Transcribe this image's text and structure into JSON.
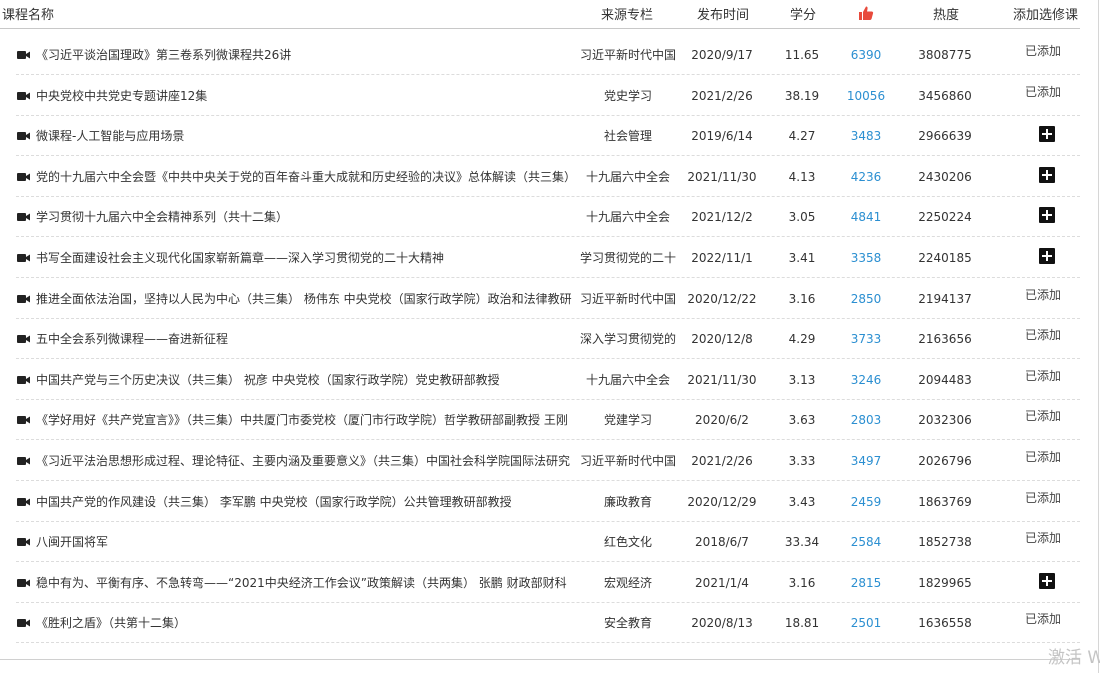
{
  "header": {
    "title": "课程名称",
    "source": "来源专栏",
    "date": "发布时间",
    "score": "学分",
    "likes_icon": "thumbs-up-icon",
    "heat": "热度",
    "action": "添加选修课"
  },
  "colors": {
    "likes": "#2b8fd1",
    "thumb": "#e84a3c",
    "plus": "#111111"
  },
  "rows": [
    {
      "title": "《习近平谈治国理政》第三卷系列微课程共26讲",
      "source": "习近平新时代中国",
      "date": "2020/9/17",
      "score": "11.65",
      "likes": "6390",
      "heat": "3808775",
      "status": "已添加"
    },
    {
      "title": "中央党校中共党史专题讲座12集",
      "source": "党史学习",
      "date": "2021/2/26",
      "score": "38.19",
      "likes": "10056",
      "heat": "3456860",
      "status": "已添加"
    },
    {
      "title": "微课程-人工智能与应用场景",
      "source": "社会管理",
      "date": "2019/6/14",
      "score": "4.27",
      "likes": "3483",
      "heat": "2966639",
      "status": ""
    },
    {
      "title": "党的十九届六中全会暨《中共中央关于党的百年奋斗重大成就和历史经验的决议》总体解读（共三集）",
      "source": "十九届六中全会",
      "date": "2021/11/30",
      "score": "4.13",
      "likes": "4236",
      "heat": "2430206",
      "status": ""
    },
    {
      "title": "学习贯彻十九届六中全会精神系列（共十二集）",
      "source": "十九届六中全会",
      "date": "2021/12/2",
      "score": "3.05",
      "likes": "4841",
      "heat": "2250224",
      "status": ""
    },
    {
      "title": "书写全面建设社会主义现代化国家崭新篇章——深入学习贯彻党的二十大精神",
      "source": "学习贯彻党的二十",
      "date": "2022/11/1",
      "score": "3.41",
      "likes": "3358",
      "heat": "2240185",
      "status": ""
    },
    {
      "title": "推进全面依法治国，坚持以人民为中心（共三集） 杨伟东 中央党校（国家行政学院）政治和法律教研",
      "source": "习近平新时代中国",
      "date": "2020/12/22",
      "score": "3.16",
      "likes": "2850",
      "heat": "2194137",
      "status": "已添加"
    },
    {
      "title": "五中全会系列微课程——奋进新征程",
      "source": "深入学习贯彻党的",
      "date": "2020/12/8",
      "score": "4.29",
      "likes": "3733",
      "heat": "2163656",
      "status": "已添加"
    },
    {
      "title": "中国共产党与三个历史决议（共三集） 祝彦 中央党校（国家行政学院）党史教研部教授",
      "source": "十九届六中全会",
      "date": "2021/11/30",
      "score": "3.13",
      "likes": "3246",
      "heat": "2094483",
      "status": "已添加"
    },
    {
      "title": "《学好用好《共产党宣言》》（共三集）中共厦门市委党校（厦门市行政学院）哲学教研部副教授 王刚",
      "source": "党建学习",
      "date": "2020/6/2",
      "score": "3.63",
      "likes": "2803",
      "heat": "2032306",
      "status": "已添加"
    },
    {
      "title": "《习近平法治思想形成过程、理论特征、主要内涵及重要意义》（共三集）中国社会科学院国际法研究",
      "source": "习近平新时代中国",
      "date": "2021/2/26",
      "score": "3.33",
      "likes": "3497",
      "heat": "2026796",
      "status": "已添加"
    },
    {
      "title": "中国共产党的作风建设（共三集） 李军鹏 中央党校（国家行政学院）公共管理教研部教授",
      "source": "廉政教育",
      "date": "2020/12/29",
      "score": "3.43",
      "likes": "2459",
      "heat": "1863769",
      "status": "已添加"
    },
    {
      "title": "八闽开国将军",
      "source": "红色文化",
      "date": "2018/6/7",
      "score": "33.34",
      "likes": "2584",
      "heat": "1852738",
      "status": "已添加"
    },
    {
      "title": "稳中有为、平衡有序、不急转弯——“2021中央经济工作会议”政策解读（共两集） 张鹏 财政部财科",
      "source": "宏观经济",
      "date": "2021/1/4",
      "score": "3.16",
      "likes": "2815",
      "heat": "1829965",
      "status": ""
    },
    {
      "title": "《胜利之盾》（共第十二集）",
      "source": "安全教育",
      "date": "2020/8/13",
      "score": "18.81",
      "likes": "2501",
      "heat": "1636558",
      "status": "已添加"
    }
  ],
  "watermark": "激活 W"
}
